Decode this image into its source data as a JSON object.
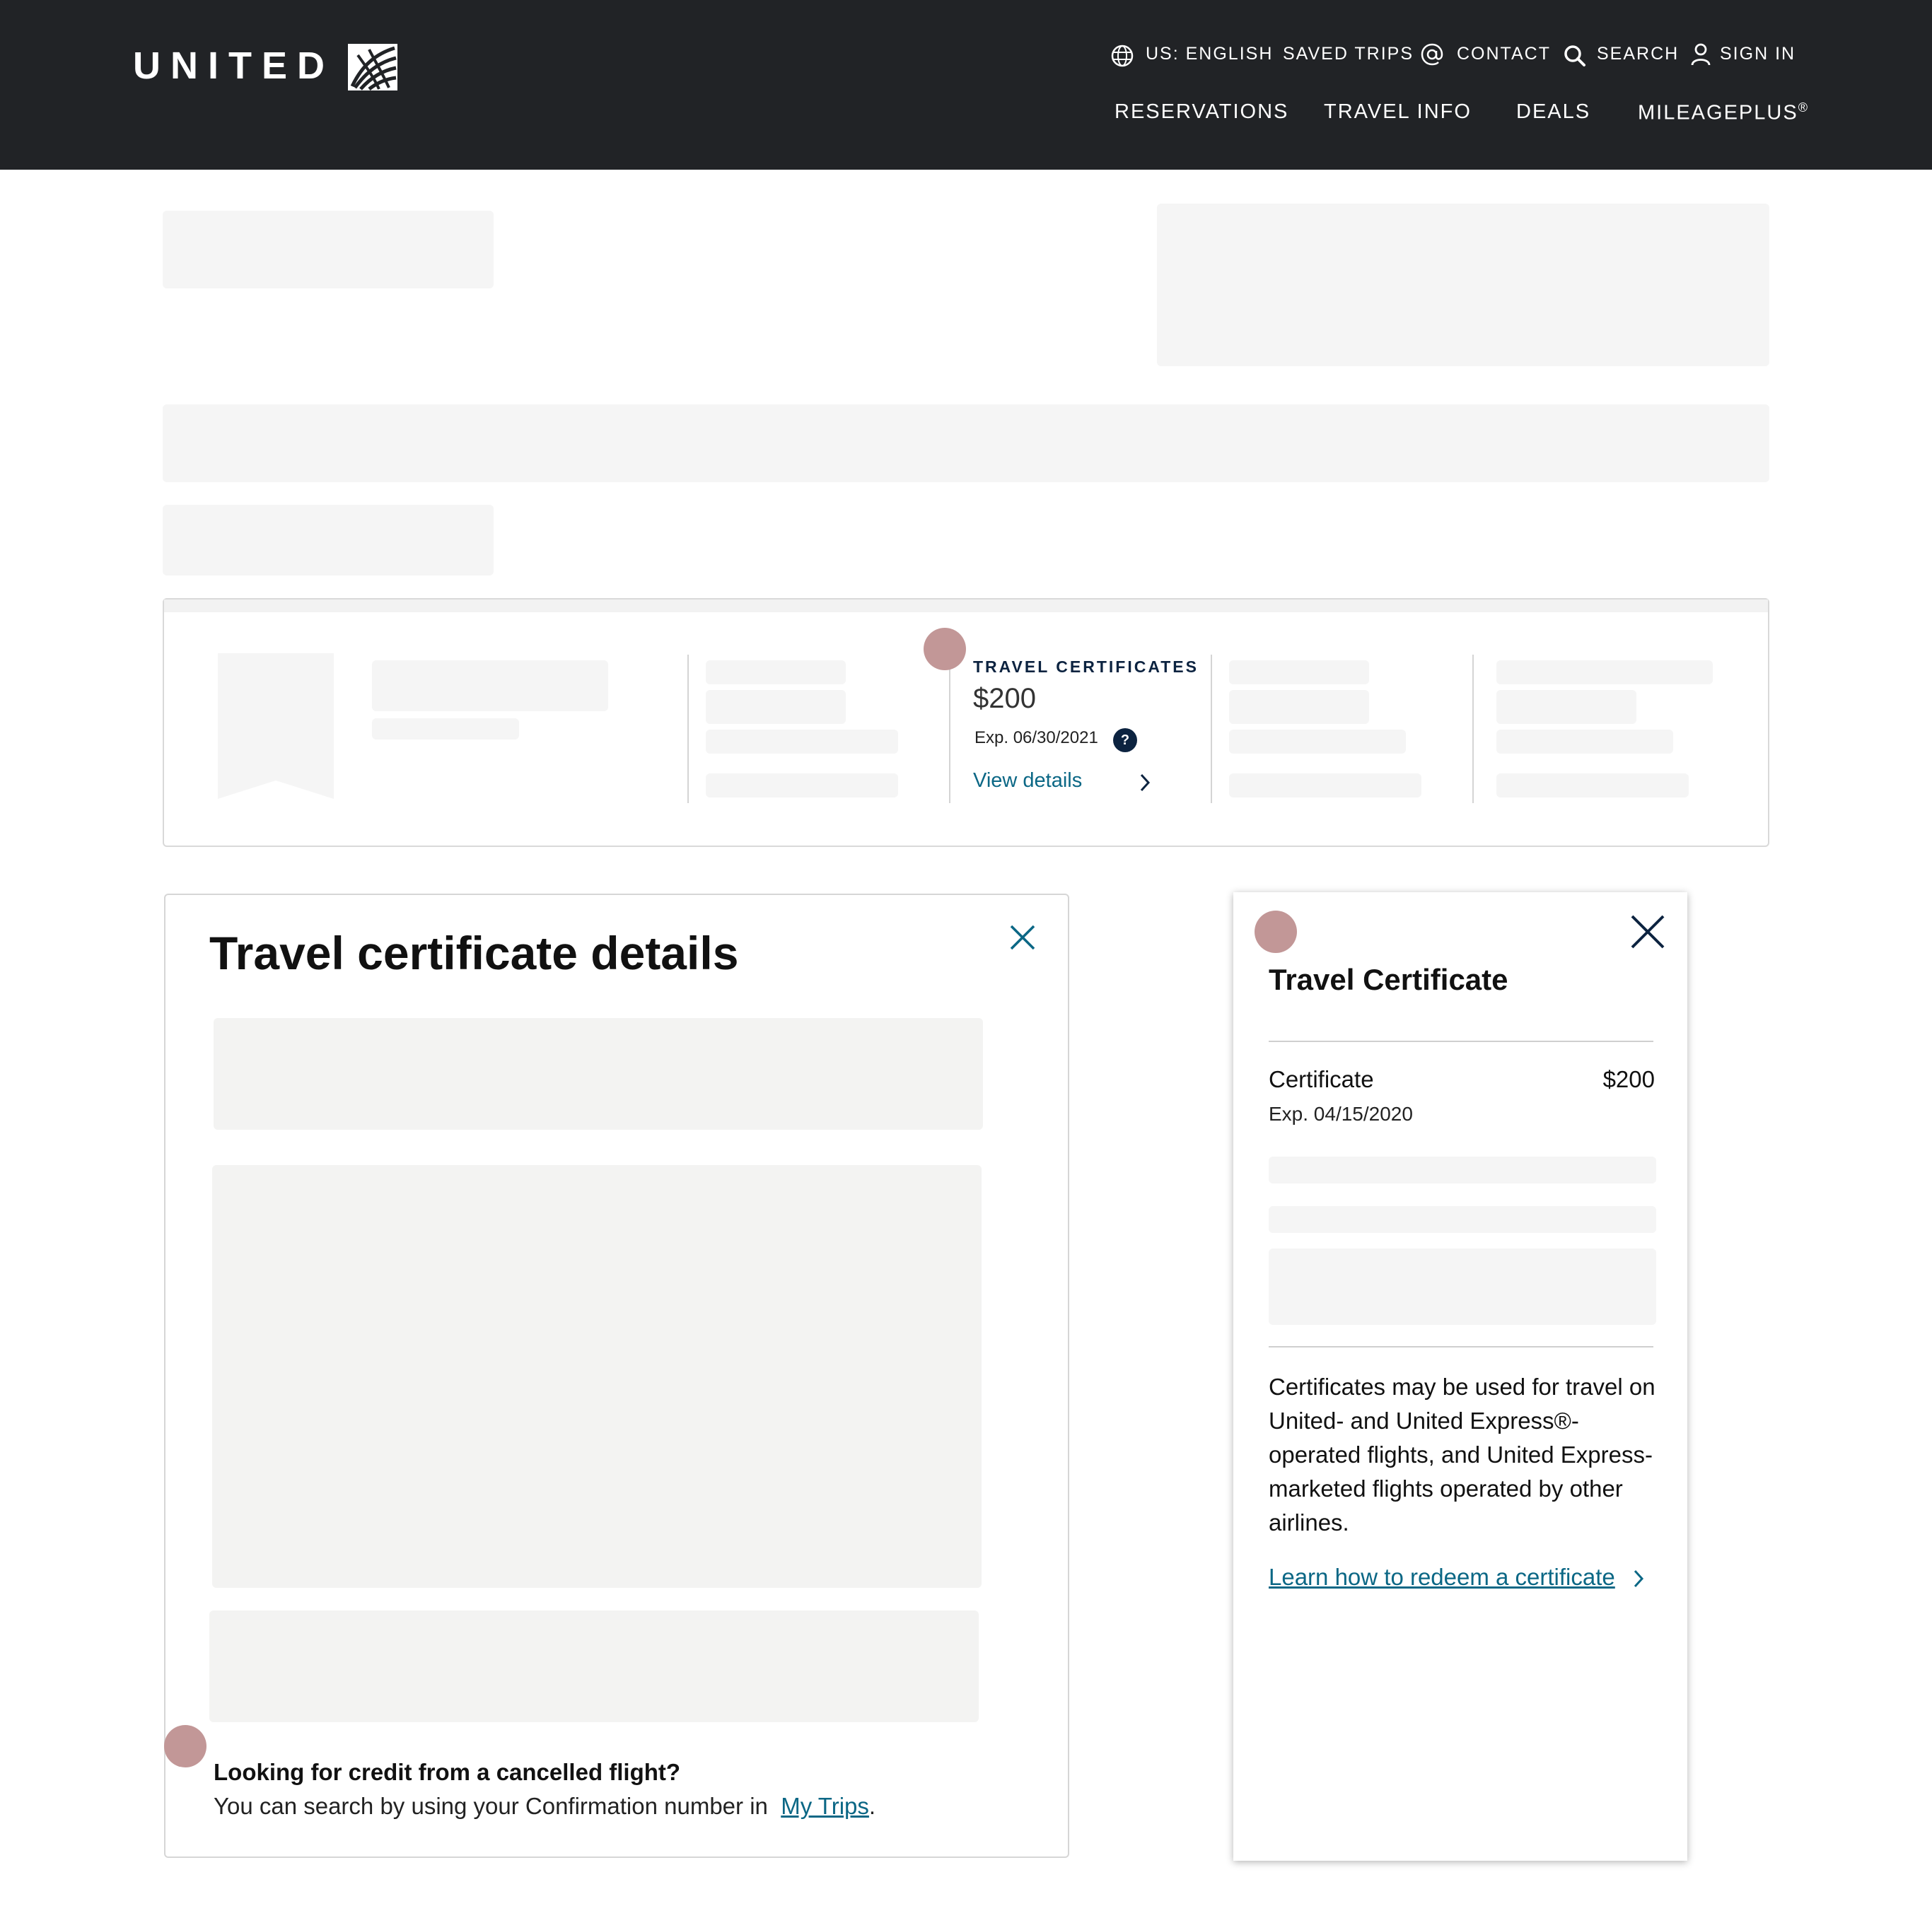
{
  "header": {
    "logo_text": "UNITED",
    "utility": {
      "language": "US: ENGLISH",
      "saved_trips": "SAVED TRIPS",
      "contact": "CONTACT",
      "search": "SEARCH",
      "sign_in": "SIGN  IN"
    },
    "nav": {
      "reservations": "RESERVATIONS",
      "travel_info": "TRAVEL INFO",
      "deals": "DEALS",
      "mileageplus": "MILEAGEPLUS",
      "mileageplus_mark": "®"
    }
  },
  "summary": {
    "travel_certificates": {
      "heading": "TRAVEL CERTIFICATES",
      "amount": "$200",
      "expiry": "Exp. 06/30/2021",
      "help_glyph": "?",
      "link": "View details"
    }
  },
  "details_modal": {
    "title": "Travel certificate details",
    "cancelled_question": "Looking for credit from a cancelled flight?",
    "cancelled_text": "You can search by using your Confirmation number in",
    "my_trips_link": "My Trips",
    "period": "."
  },
  "certificate_panel": {
    "title": "Travel Certificate",
    "certificate_label": "Certificate",
    "certificate_value": "$200",
    "certificate_expiry": "Exp. 04/15/2020",
    "description": "Certificates may be used for travel on United- and United Express®-operated flights, and United Express-marketed flights operated by other airlines.",
    "learn_link": "Learn how to redeem a certificate"
  },
  "icons": {
    "language": "globe-icon",
    "contact": "at-icon",
    "search": "search-icon",
    "sign_in": "user-icon",
    "help": "help-icon",
    "chevron": "chevron-right-icon",
    "close": "close-icon"
  },
  "colors": {
    "header_bg": "#212326",
    "brand_navy": "#0c2340",
    "link": "#0b6785",
    "skeleton": "#f5f5f5",
    "annotation_marker": "#c29797"
  }
}
